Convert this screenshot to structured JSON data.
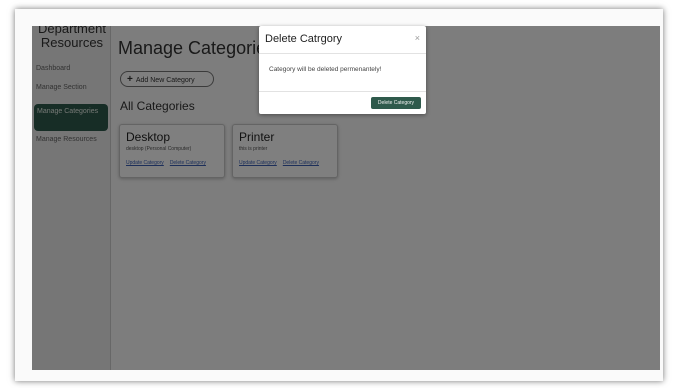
{
  "sidebar": {
    "brand": "Department Resources",
    "items": [
      {
        "label": "Dashboard"
      },
      {
        "label": "Manage Section"
      },
      {
        "label": "Manage Categories"
      },
      {
        "label": "Manage Resources"
      }
    ]
  },
  "main": {
    "page_title": "Manage Categories",
    "add_button_label": "Add New Category",
    "section_title": "All Categories",
    "cards": [
      {
        "title": "Desktop",
        "description": "desktop (Personal Computer)",
        "update_label": "Update Category",
        "delete_label": "Delete Category"
      },
      {
        "title": "Printer",
        "description": "this is printer",
        "update_label": "Update Category",
        "delete_label": "Delete Category"
      }
    ]
  },
  "modal": {
    "title": "Delete Catrgory",
    "message": "Category will be deleted permenantely!",
    "confirm_label": "Delete Category",
    "close_glyph": "×"
  },
  "colors": {
    "accent": "#2f5a4c",
    "overlay": "rgba(0,0,0,0.5)",
    "link": "#3a5fb5"
  }
}
